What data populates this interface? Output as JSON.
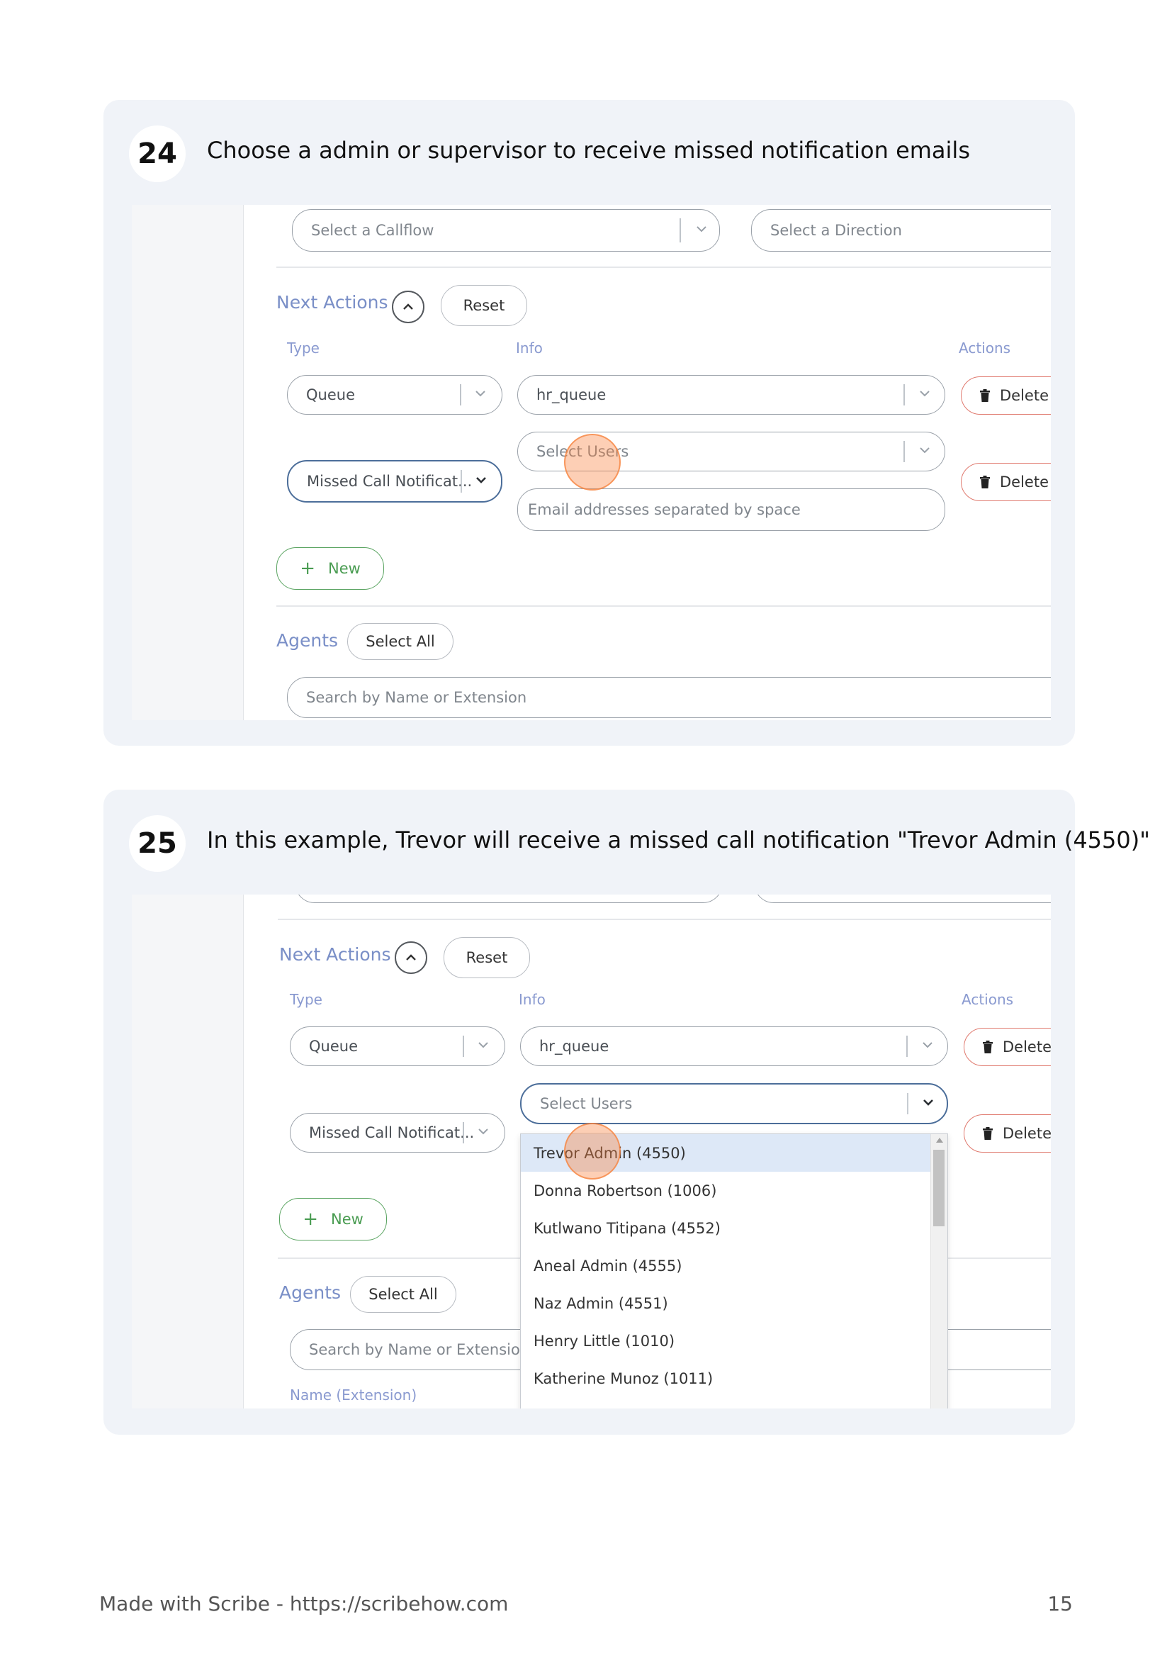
{
  "steps": [
    {
      "number": "24",
      "instruction": "Choose a admin or supervisor to receive missed notification emails",
      "screenshot": {
        "callflow_placeholder": "Select a Callflow",
        "direction_placeholder": "Select a Direction",
        "next_actions_label": "Next Actions",
        "reset_label": "Reset",
        "columns": {
          "type": "Type",
          "info": "Info",
          "actions": "Actions"
        },
        "rows": [
          {
            "type": "Queue",
            "info": "hr_queue",
            "delete": "Delete"
          },
          {
            "type": "Missed Call Notificat...",
            "users_placeholder": "Select Users",
            "emails_placeholder": "Email addresses separated by space",
            "delete": "Delete"
          }
        ],
        "new_label": "New",
        "agents_label": "Agents",
        "select_all_label": "Select All",
        "search_placeholder": "Search by Name or Extension"
      }
    },
    {
      "number": "25",
      "instruction": "In this example, Trevor will receive a missed call notification \"Trevor Admin (4550)\"",
      "screenshot": {
        "next_actions_label": "Next Actions",
        "reset_label": "Reset",
        "columns": {
          "type": "Type",
          "info": "Info",
          "actions": "Actions"
        },
        "rows": [
          {
            "type": "Queue",
            "info": "hr_queue",
            "delete": "Delete"
          },
          {
            "type": "Missed Call Notificat...",
            "users_placeholder": "Select Users",
            "delete": "Delete"
          }
        ],
        "new_label": "New",
        "agents_label": "Agents",
        "select_all_label": "Select All",
        "search_placeholder": "Search by Name or Extension",
        "name_column": "Name (Extension)",
        "user_options": [
          "Trevor Admin (4550)",
          "Donna Robertson (1006)",
          "Kutlwano Titipana (4552)",
          "Aneal Admin (4555)",
          "Naz Admin (4551)",
          "Henry Little (1010)",
          "Katherine Munoz (1011)"
        ],
        "selected_option": "Trevor Admin (4550)"
      }
    }
  ],
  "footer": {
    "made_with": "Made with Scribe - https://scribehow.com",
    "page_number": "15"
  },
  "colors": {
    "card_background": "#f0f3f8",
    "section_label": "#7a8fc7",
    "new_button": "#4a9c52",
    "delete_border": "#e07a6f",
    "focus_border": "#4c6e9a",
    "highlight": "#fa823c",
    "selected_option": "#dde8f7"
  }
}
